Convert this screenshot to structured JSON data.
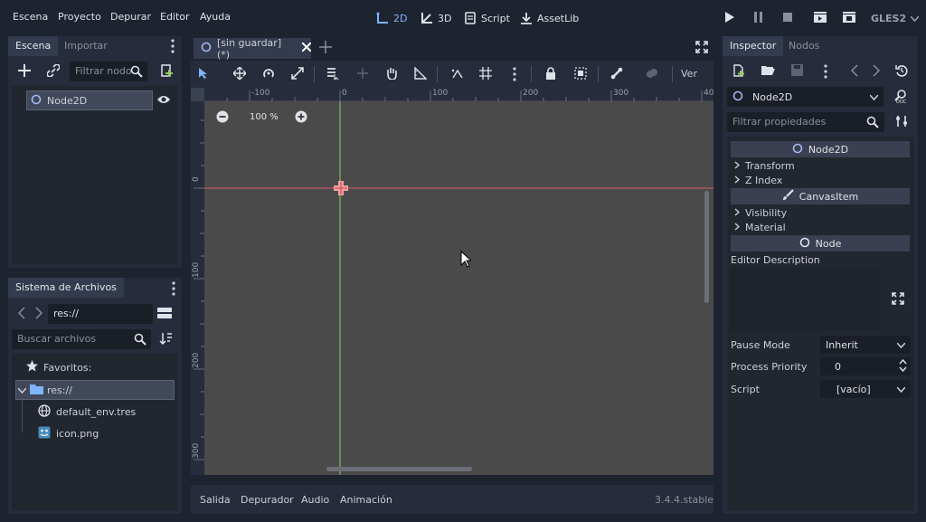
{
  "menu": {
    "items": [
      "Escena",
      "Proyecto",
      "Depurar",
      "Editor",
      "Ayuda"
    ]
  },
  "workspaces": {
    "2d": "2D",
    "3d": "3D",
    "script": "Script",
    "assetlib": "AssetLib"
  },
  "renderer": "GLES2",
  "scene_panel": {
    "tabs": [
      "Escena",
      "Importar"
    ],
    "filter_placeholder": "Filtrar nodo",
    "tree": [
      {
        "label": "Node2D"
      }
    ]
  },
  "filesystem_panel": {
    "title": "Sistema de Archivos",
    "path": "res://",
    "search_placeholder": "Buscar archivos",
    "items": [
      {
        "label": "Favoritos:",
        "icon": "star-icon"
      },
      {
        "label": "res://",
        "icon": "folder-icon"
      },
      {
        "label": "default_env.tres",
        "icon": "globe-icon"
      },
      {
        "label": "icon.png",
        "icon": "image-icon"
      }
    ]
  },
  "editor_tab": {
    "label": "[sin guardar](*)"
  },
  "viewport": {
    "zoom": "100 %",
    "view_menu": "Ver",
    "ruler_h": [
      "-100",
      "0",
      "100",
      "200",
      "300",
      "40"
    ],
    "ruler_v": [
      "0",
      "100",
      "200",
      "300"
    ]
  },
  "bottom": {
    "tabs": [
      "Salida",
      "Depurador",
      "Audio",
      "Animación"
    ],
    "version": "3.4.4.stable"
  },
  "inspector": {
    "tabs": [
      "Inspector",
      "Nodos"
    ],
    "node_select": "Node2D",
    "filter_placeholder": "Filtrar propiedades",
    "sections": {
      "node2d": "Node2D",
      "transform": "Transform",
      "zindex": "Z Index",
      "canvasitem": "CanvasItem",
      "visibility": "Visibility",
      "material": "Material",
      "node": "Node"
    },
    "editor_description": "Editor Description",
    "props": {
      "pause_mode_label": "Pause Mode",
      "pause_mode_value": "Inherit",
      "process_priority_label": "Process Priority",
      "process_priority_value": "0",
      "script_label": "Script",
      "script_value": "[vacío]"
    }
  },
  "colors": {
    "accent": "#7fb3ff",
    "bg": "#1e2330",
    "panel": "#262c3b",
    "viewport": "#4a4a4a",
    "axis_x": "#e05a6a",
    "axis_y": "#8fcf5a"
  }
}
